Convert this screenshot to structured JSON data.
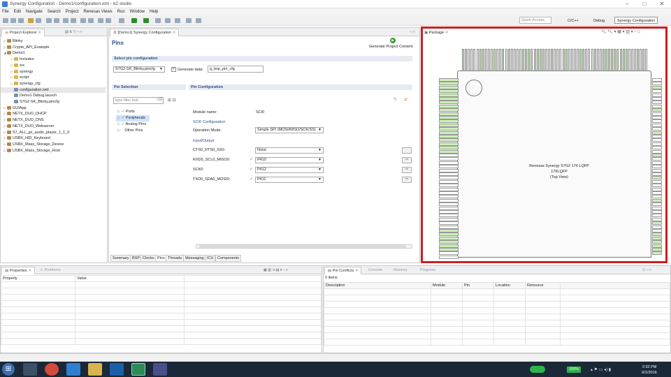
{
  "window": {
    "title": "Synergy Configuration - Demo1/configuration.xml - e2 studio"
  },
  "menu": [
    "File",
    "Edit",
    "Navigate",
    "Search",
    "Project",
    "Renesas Views",
    "Run",
    "Window",
    "Help"
  ],
  "quick_access": "Quick Access",
  "perspectives": [
    "C/C++",
    "Debug",
    "Synergy Configuration"
  ],
  "project_explorer": {
    "title": "Project Explorer",
    "items": [
      {
        "label": "Blinky",
        "depth": 0,
        "exp": "▷"
      },
      {
        "label": "Crypto_API_Example",
        "depth": 0,
        "exp": "▷"
      },
      {
        "label": "Demo1",
        "depth": 0,
        "exp": "◢"
      },
      {
        "label": "Includes",
        "depth": 1,
        "exp": "▷"
      },
      {
        "label": "src",
        "depth": 1,
        "exp": "▷"
      },
      {
        "label": "synergy",
        "depth": 1,
        "exp": "▷"
      },
      {
        "label": "script",
        "depth": 1,
        "exp": "▷"
      },
      {
        "label": "synergy_cfg",
        "depth": 1,
        "exp": "▷"
      },
      {
        "label": "configuration.xml",
        "depth": 1,
        "exp": "",
        "selected": true
      },
      {
        "label": "Demo1 Debug.launch",
        "depth": 1,
        "exp": ""
      },
      {
        "label": "S7G2-SK_Blinky.pincfg",
        "depth": 1,
        "exp": ""
      },
      {
        "label": "GUIApp",
        "depth": 0,
        "exp": "▷"
      },
      {
        "label": "NETX_DUO_DHCP",
        "depth": 0,
        "exp": "▷"
      },
      {
        "label": "NETX_DUO_DNS",
        "depth": 0,
        "exp": "▷"
      },
      {
        "label": "NETX_DUO_Webserver",
        "depth": 0,
        "exp": "▷"
      },
      {
        "label": "S7_ALL_gx_audio_player_1_1_0",
        "depth": 0,
        "exp": "▷"
      },
      {
        "label": "USBX_HID_Keyboard",
        "depth": 0,
        "exp": "▷"
      },
      {
        "label": "USBX_Mass_Storage_Device",
        "depth": 0,
        "exp": "▷"
      },
      {
        "label": "USBX_Mass_Storage_Host",
        "depth": 0,
        "exp": "▷"
      }
    ]
  },
  "editor": {
    "tab": "[Demo1] Synergy Configuration",
    "heading": "Pins",
    "generate": "Generate Project Content",
    "select_pin_cfg_title": "Select pin configuration",
    "pin_cfg_value": "S7G2-SK_Blinky.pincfg",
    "generate_data_label": "Generate data:",
    "generate_data_value": "g_bsp_pin_cfg",
    "pin_selection_title": "Pin Selection",
    "filter_placeholder": "type filter text",
    "pin_tree": [
      "Ports",
      "Peripherals",
      "Analog Pins",
      "Other Pins"
    ],
    "pin_config_title": "Pin Configuration",
    "module_name_label": "Module name:",
    "module_name_value": "SCI0",
    "sci0_config_title": "SCI0 Configuration",
    "op_mode_label": "Operation Mode:",
    "op_mode_value": "Simple SPI (MOSI/MISO/SCK/SS)",
    "io_title": "Input/Output",
    "io_rows": [
      {
        "label": "CTS0_RTS0_SS0:",
        "value": "None",
        "checked": false
      },
      {
        "label": "RXD0_SCL0_MISO0:",
        "value": "P410",
        "checked": true
      },
      {
        "label": "SCK0:",
        "value": "P412",
        "checked": true
      },
      {
        "label": "TXD0_SDA0_MOSI0:",
        "value": "P411",
        "checked": true
      }
    ],
    "bottom_tabs": [
      "Summary",
      "BSP",
      "Clocks",
      "Pins",
      "Threads",
      "Messaging",
      "ICU",
      "Components"
    ]
  },
  "package": {
    "tab": "Package",
    "chip_line1": "Renesas Synergy S7G2 176 LQFP",
    "chip_line2": "176LQFP",
    "chip_line3": "(Top View)"
  },
  "properties": {
    "tabs": [
      "Properties",
      "Problems"
    ],
    "col_property": "Property",
    "col_value": "Value"
  },
  "conflicts": {
    "tabs": [
      "Pin Conflicts",
      "Console",
      "Memory",
      "Progress"
    ],
    "count": "0 items",
    "columns": [
      "Description",
      "Module",
      "Pin",
      "Location",
      "Resource"
    ]
  },
  "taskbar": {
    "time": "2:32 PM",
    "date": "6/1/2016",
    "battery": "100%"
  },
  "colors": {
    "accent": "#cc1f1f",
    "pin_green": "#c8f0b8",
    "taskbar": "#1b2838"
  }
}
